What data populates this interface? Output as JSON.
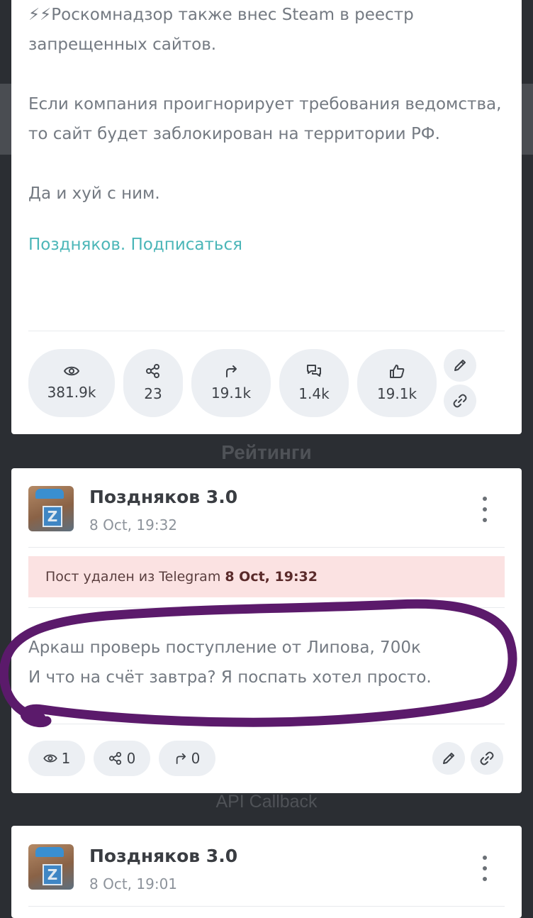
{
  "post1": {
    "lines": [
      "⚡⚡Роскомнадзор также внес Steam в реестр запрещенных сайтов.",
      "Если компания проигнорирует требования ведомства, то сайт будет заблокирован на территории РФ.",
      "Да и хуй с ним."
    ],
    "subscribe_link": "Поздняков. Подписаться",
    "stats": {
      "views": "381.9k",
      "shares": "23",
      "forwards": "19.1k",
      "comments": "1.4k",
      "likes": "19.1k"
    }
  },
  "sections": {
    "ratings": "Рейтинги",
    "api": "API Callback"
  },
  "post2": {
    "author": "Поздняков 3.0",
    "time": "8 Oct, 19:32",
    "deleted_label": "Пост удален из Telegram",
    "deleted_time": "8 Oct, 19:32",
    "text_line1": "Аркаш проверь поступление от Липова, 700к",
    "text_line2": "И что на счёт завтра? Я поспать хотел просто.",
    "stats": {
      "views": "1",
      "shares": "0",
      "forwards": "0"
    }
  },
  "post3": {
    "author": "Поздняков 3.0",
    "time": "8 Oct, 19:01"
  },
  "colors": {
    "background": "#2b2e33",
    "card": "#ffffff",
    "link": "#4bb6b8",
    "deleted_banner": "#fbe2e2",
    "annotation": "#5b1a6b"
  },
  "icons": [
    "lightning-icon",
    "eye-icon",
    "share-icon",
    "forward-icon",
    "comments-icon",
    "like-icon",
    "pencil-icon",
    "link-icon",
    "kebab-menu-icon"
  ]
}
